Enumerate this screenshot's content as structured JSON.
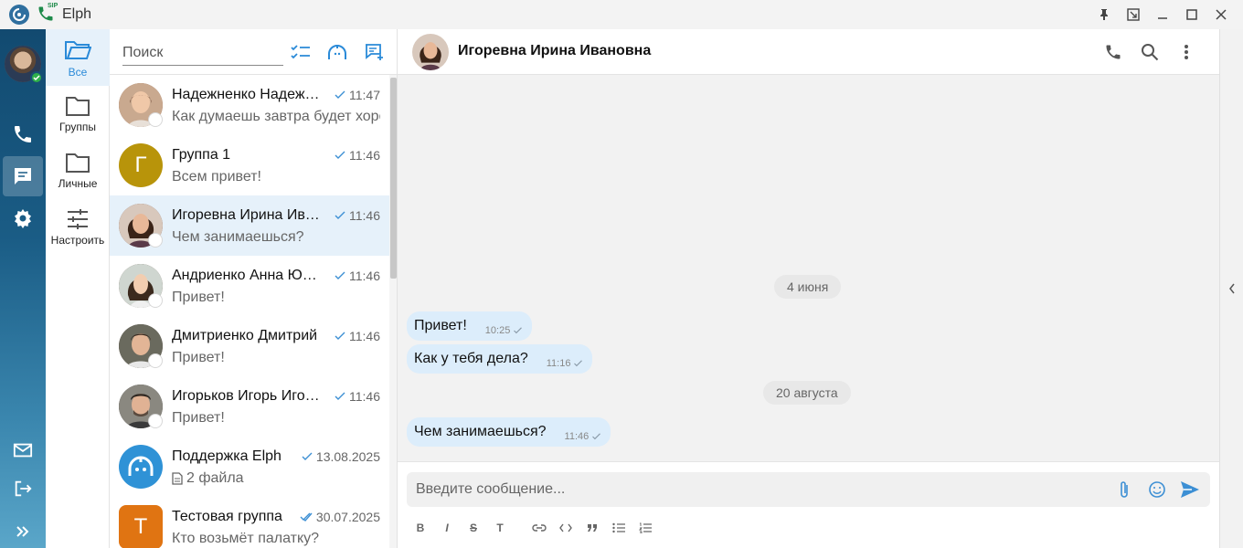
{
  "window": {
    "title": "Elph",
    "sip_badge": "SIP"
  },
  "rail": {
    "items": [
      {
        "icon": "phone-icon"
      },
      {
        "icon": "chat-icon",
        "active": true
      },
      {
        "icon": "gear-icon"
      },
      {
        "icon": "mail-icon"
      },
      {
        "icon": "logout-icon"
      },
      {
        "icon": "expand-icon"
      }
    ]
  },
  "folders": [
    {
      "label": "Все",
      "active": true
    },
    {
      "label": "Группы"
    },
    {
      "label": "Личные"
    },
    {
      "label": "Настроить"
    }
  ],
  "chatlist": {
    "search_placeholder": "Поиск",
    "chats": [
      {
        "name": "Надежненко Надежда",
        "time": "11:47",
        "preview": "Как думаешь завтра будет хорошая погода?",
        "avatar_color": "#8a5a44",
        "check": "single"
      },
      {
        "name": "Группа 1",
        "time": "11:46",
        "preview": "Всем привет!",
        "avatar_letter": "Г",
        "avatar_color": "#b8940a",
        "check": "single"
      },
      {
        "name": "Игоревна Ирина Ивановна",
        "time": "11:46",
        "preview": "Чем занимаешься?",
        "avatar_color": "#6b3a2a",
        "check": "single",
        "selected": true
      },
      {
        "name": "Андриенко Анна Юрьевна",
        "time": "11:46",
        "preview": "Привет!",
        "avatar_color": "#4a3528",
        "check": "single"
      },
      {
        "name": "Дмитриенко Дмитрий",
        "time": "11:46",
        "preview": "Привет!",
        "avatar_color": "#5a4a3e",
        "check": "single"
      },
      {
        "name": "Игорьков Игорь Игоревич",
        "time": "11:46",
        "preview": "Привет!",
        "avatar_color": "#3e3a36",
        "check": "single"
      },
      {
        "name": "Поддержка Elph",
        "time": "13.08.2025",
        "preview": "2 файла",
        "avatar_color": "#2f92d6",
        "check": "single",
        "file_icon": true
      },
      {
        "name": "Тестовая группа",
        "time": "30.07.2025",
        "preview": "Кто возьмёт палатку?",
        "avatar_letter": "Т",
        "avatar_color": "#e07412",
        "check": "double"
      }
    ]
  },
  "chat": {
    "contact_name": "Игоревна Ирина Ивановна",
    "dates": [
      "4 июня",
      "20 августа"
    ],
    "messages": [
      {
        "text": "Привет!",
        "time": "10:25"
      },
      {
        "text": "Как у тебя дела?",
        "time": "11:16"
      },
      {
        "text": "Чем занимаешься?",
        "time": "11:46"
      }
    ],
    "composer_placeholder": "Введите сообщение...",
    "format_buttons": [
      "B",
      "I",
      "S",
      "T"
    ]
  },
  "colors": {
    "accent": "#2a8ad8",
    "bubble": "#dcedfb",
    "selected_row": "#e6f1fa",
    "rail_top": "#124a70"
  }
}
